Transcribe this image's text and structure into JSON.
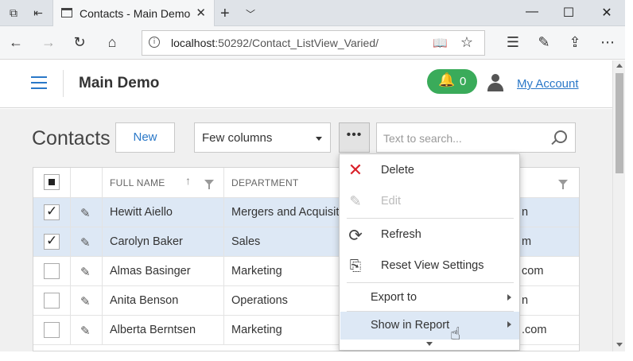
{
  "browser": {
    "tab_title": "Contacts - Main Demo",
    "url_host": "localhost",
    "url_path": ":50292/Contact_ListView_Varied/"
  },
  "app": {
    "title": "Main Demo",
    "notification_count": "0",
    "account_label": "My Account",
    "accent_color": "#2a78c8",
    "notification_color": "#3aab5a"
  },
  "toolbar": {
    "page_title": "Contacts",
    "new_label": "New",
    "view_selected": "Few columns",
    "more_label": "•••",
    "search_placeholder": "Text to search..."
  },
  "grid": {
    "columns": [
      "FULL NAME",
      "DEPARTMENT"
    ],
    "rows": [
      {
        "name": "Hewitt Aiello",
        "department": "Mergers and Acquisitions",
        "email_tail": "n",
        "selected": true
      },
      {
        "name": "Carolyn Baker",
        "department": "Sales",
        "email_tail": "m",
        "selected": true
      },
      {
        "name": "Almas Basinger",
        "department": "Marketing",
        "email_tail": "com",
        "selected": false
      },
      {
        "name": "Anita Benson",
        "department": "Operations",
        "email_tail": "n",
        "selected": false
      },
      {
        "name": "Alberta Berntsen",
        "department": "Marketing",
        "email_tail": ".com",
        "selected": false
      }
    ]
  },
  "menu": {
    "items": [
      {
        "label": "Delete",
        "icon": "delete-x-icon",
        "enabled": true
      },
      {
        "label": "Edit",
        "icon": "pencil-icon",
        "enabled": false
      },
      {
        "label": "Refresh",
        "icon": "refresh-icon",
        "enabled": true
      },
      {
        "label": "Reset View Settings",
        "icon": "reset-view-icon",
        "enabled": true
      },
      {
        "label": "Export to",
        "submenu": true
      },
      {
        "label": "Show in Report",
        "submenu": true,
        "hover": true
      }
    ]
  }
}
